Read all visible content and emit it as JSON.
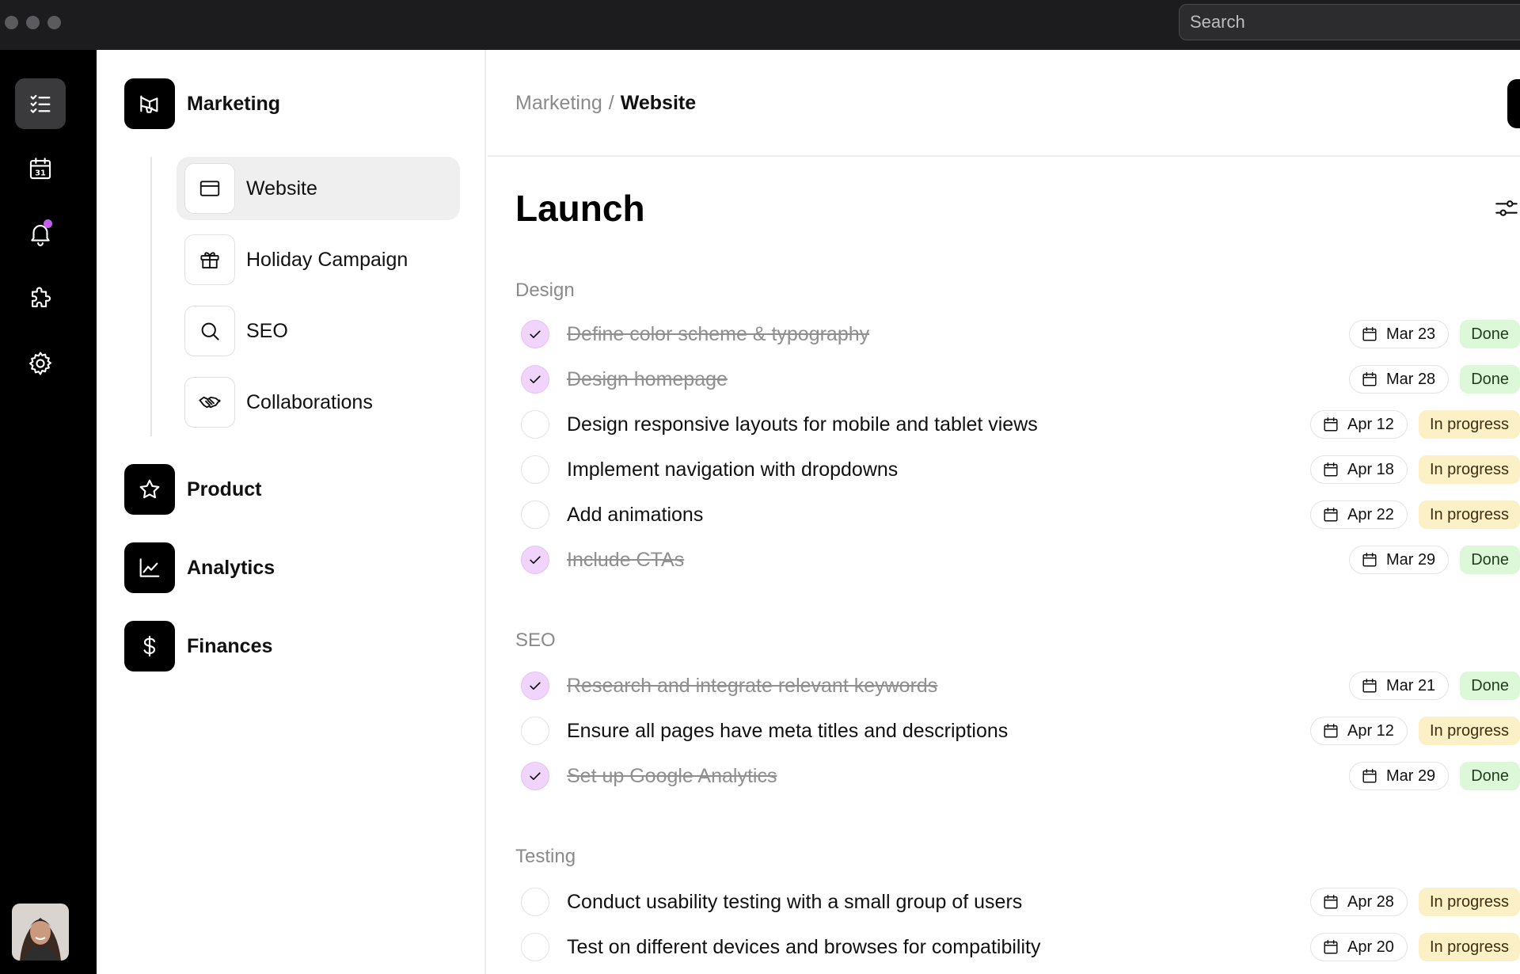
{
  "titlebar": {
    "search_placeholder": "Search"
  },
  "rail": {
    "items": [
      {
        "name": "tasks",
        "active": true
      },
      {
        "name": "calendar",
        "day": "31"
      },
      {
        "name": "notifications"
      },
      {
        "name": "plugins"
      },
      {
        "name": "settings"
      }
    ]
  },
  "sidebar": {
    "marketing": "Marketing",
    "subs": [
      "Website",
      "Holiday Campaign",
      "SEO",
      "Collaborations"
    ],
    "product": "Product",
    "analytics": "Analytics",
    "finances": "Finances"
  },
  "main": {
    "breadcrumb": {
      "parent": "Marketing",
      "separator": "/",
      "current": "Website"
    },
    "title": "Launch",
    "sections": [
      {
        "title": "Design",
        "tasks": [
          {
            "text": "Define color scheme & typography",
            "date": "Mar 23",
            "status": "Done",
            "done": true
          },
          {
            "text": "Design homepage",
            "date": "Mar 28",
            "status": "Done",
            "done": true
          },
          {
            "text": "Design responsive layouts for mobile and tablet views",
            "date": "Apr 12",
            "status": "In progress",
            "done": false
          },
          {
            "text": "Implement navigation with dropdowns",
            "date": "Apr 18",
            "status": "In progress",
            "done": false
          },
          {
            "text": "Add animations",
            "date": "Apr 22",
            "status": "In progress",
            "done": false
          },
          {
            "text": "Include CTAs",
            "date": "Mar 29",
            "status": "Done",
            "done": true
          }
        ]
      },
      {
        "title": "SEO",
        "tasks": [
          {
            "text": "Research and integrate relevant keywords",
            "date": "Mar 21",
            "status": "Done",
            "done": true
          },
          {
            "text": "Ensure all pages have meta titles and descriptions",
            "date": "Apr 12",
            "status": "In progress",
            "done": false
          },
          {
            "text": "Set up Google Analytics",
            "date": "Mar 29",
            "status": "Done",
            "done": true
          }
        ]
      },
      {
        "title": "Testing",
        "tasks": [
          {
            "text": "Conduct usability testing with a small group of users",
            "date": "Apr 28",
            "status": "In progress",
            "done": false
          },
          {
            "text": "Test on different devices and browses for compatibility",
            "date": "Apr 20",
            "status": "In progress",
            "done": false
          }
        ]
      }
    ]
  },
  "colors": {
    "rail_bg": "#000000",
    "titlebar_bg": "#1c1c1e",
    "check_done": "#f1d4fb",
    "status_done": "#dcf8d8",
    "status_progress": "#fbf0c6",
    "notification_dot": "#c65bf0"
  }
}
